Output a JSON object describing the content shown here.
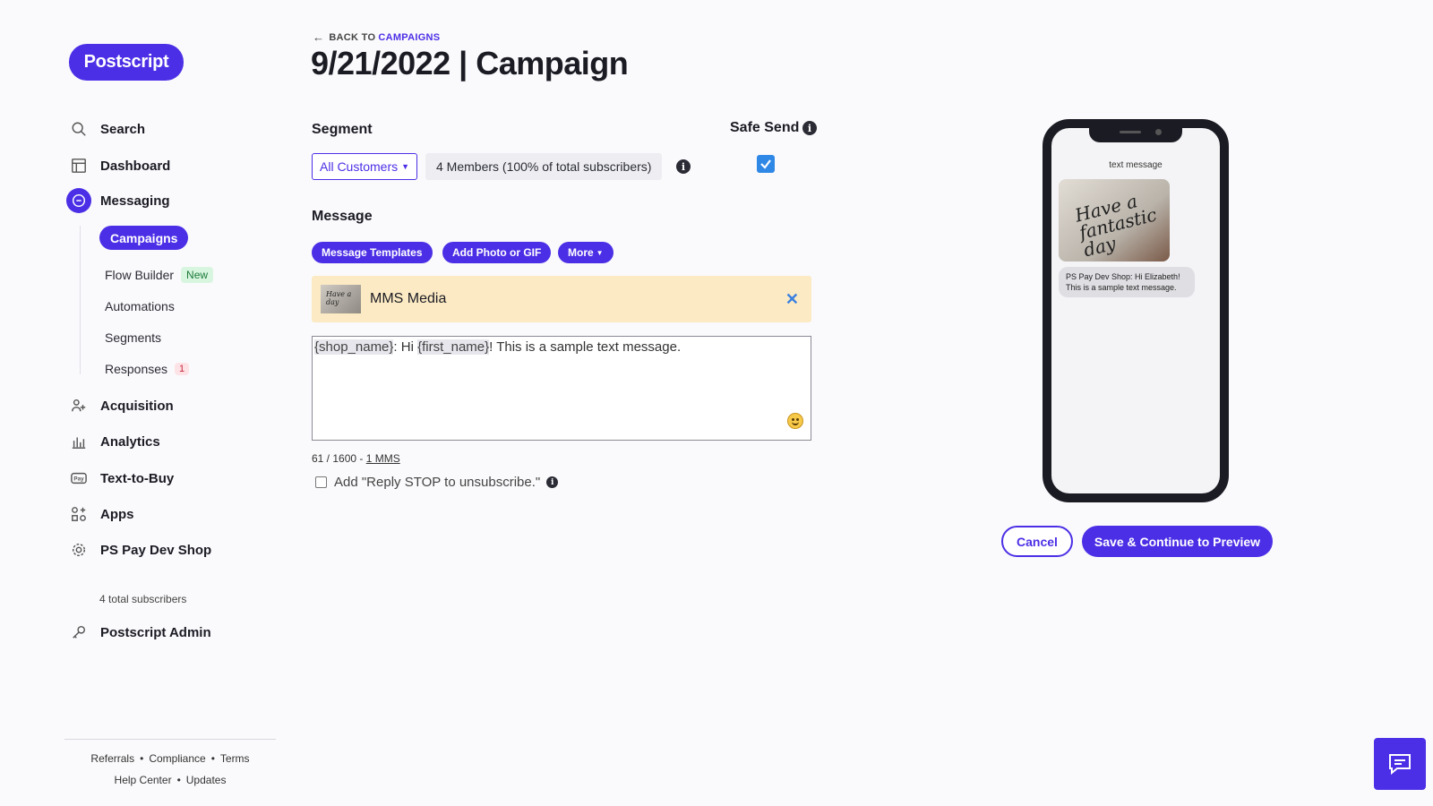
{
  "brand": {
    "logo_text": "Postscript",
    "accent": "#4b2fe6"
  },
  "sidebar": {
    "items": [
      {
        "label": "Search",
        "icon": "search-icon"
      },
      {
        "label": "Dashboard",
        "icon": "dashboard-icon"
      },
      {
        "label": "Messaging",
        "icon": "chat-bubble-icon"
      },
      {
        "label": "Acquisition",
        "icon": "users-plus-icon"
      },
      {
        "label": "Analytics",
        "icon": "bar-chart-icon"
      },
      {
        "label": "Text-to-Buy",
        "icon": "pay-icon"
      },
      {
        "label": "Apps",
        "icon": "apps-grid-icon"
      },
      {
        "label": "PS Pay Dev Shop",
        "icon": "gear-icon"
      }
    ],
    "messaging_sub": [
      {
        "label": "Campaigns"
      },
      {
        "label": "Flow Builder",
        "badge": "New"
      },
      {
        "label": "Automations"
      },
      {
        "label": "Segments"
      },
      {
        "label": "Responses",
        "badge": "1"
      }
    ],
    "subscribers_text": "4 total subscribers",
    "admin": {
      "label": "Postscript Admin",
      "icon": "key-icon"
    },
    "footer": [
      "Referrals",
      "Compliance",
      "Terms",
      "Help Center",
      "Updates"
    ]
  },
  "header": {
    "back_prefix": "BACK TO",
    "back_link": "CAMPAIGNS",
    "title": "9/21/2022 | Campaign"
  },
  "segment": {
    "label": "Segment",
    "selected": "All Customers",
    "members": "4 Members (100% of total subscribers)"
  },
  "safe_send": {
    "label": "Safe Send",
    "checked": true
  },
  "message": {
    "label": "Message",
    "buttons": [
      "Message Templates",
      "Add Photo or GIF",
      "More"
    ],
    "media_label": "MMS Media",
    "text_parts": [
      "{shop_name}",
      ": Hi ",
      "{first_name}",
      "! This is a sample text message."
    ],
    "char_count": "61 / 1600",
    "separator": " - ",
    "mms_link": "1 MMS",
    "stop_label": "Add \"Reply STOP to unsubscribe.\""
  },
  "preview": {
    "label": "text message",
    "image_text": "Have a fantastic day",
    "bubble": "PS Pay Dev Shop: Hi Elizabeth! This is a sample text message."
  },
  "actions": {
    "cancel": "Cancel",
    "save": "Save & Continue to Preview"
  }
}
